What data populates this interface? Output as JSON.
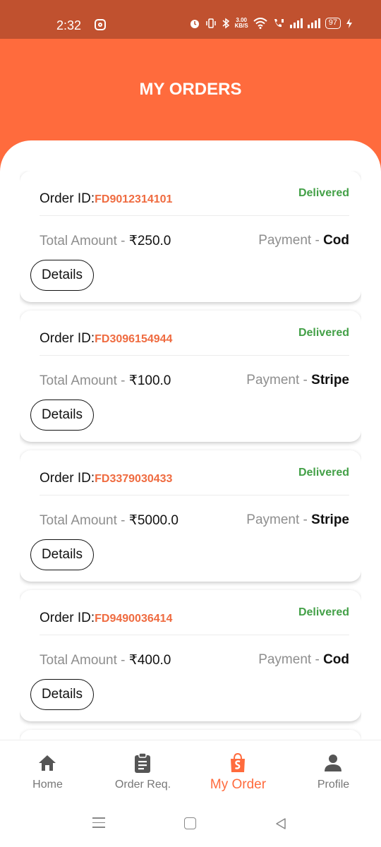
{
  "status_bar": {
    "time": "2:32",
    "net_speed_value": "3.00",
    "net_speed_unit": "KB/S",
    "battery": "97"
  },
  "header": {
    "title": "MY ORDERS",
    "color": "#ff6b3d"
  },
  "orders": [
    {
      "id_label": "Order ID:",
      "id": "FD9012314101",
      "status": "Delivered",
      "amount_label": "Total Amount - ",
      "amount": "₹250.0",
      "payment_label": "Payment - ",
      "payment": "Cod",
      "details_label": "Details"
    },
    {
      "id_label": "Order ID:",
      "id": "FD3096154944",
      "status": "Delivered",
      "amount_label": "Total Amount - ",
      "amount": "₹100.0",
      "payment_label": "Payment - ",
      "payment": "Stripe",
      "details_label": "Details"
    },
    {
      "id_label": "Order ID:",
      "id": "FD3379030433",
      "status": "Delivered",
      "amount_label": "Total Amount - ",
      "amount": "₹5000.0",
      "payment_label": "Payment - ",
      "payment": "Stripe",
      "details_label": "Details"
    },
    {
      "id_label": "Order ID:",
      "id": "FD9490036414",
      "status": "Delivered",
      "amount_label": "Total Amount - ",
      "amount": "₹400.0",
      "payment_label": "Payment - ",
      "payment": "Cod",
      "details_label": "Details"
    }
  ],
  "nav": {
    "items": [
      {
        "label": "Home",
        "icon": "home-icon"
      },
      {
        "label": "Order Req.",
        "icon": "clipboard-icon"
      },
      {
        "label": "My Order",
        "icon": "shopping-bag-icon",
        "active": true
      },
      {
        "label": "Profile",
        "icon": "person-icon"
      }
    ],
    "active_color": "#ff6b3d"
  },
  "colors": {
    "status_bar": "#c0512f",
    "order_id": "#ef6b40",
    "delivered": "#43a047"
  }
}
